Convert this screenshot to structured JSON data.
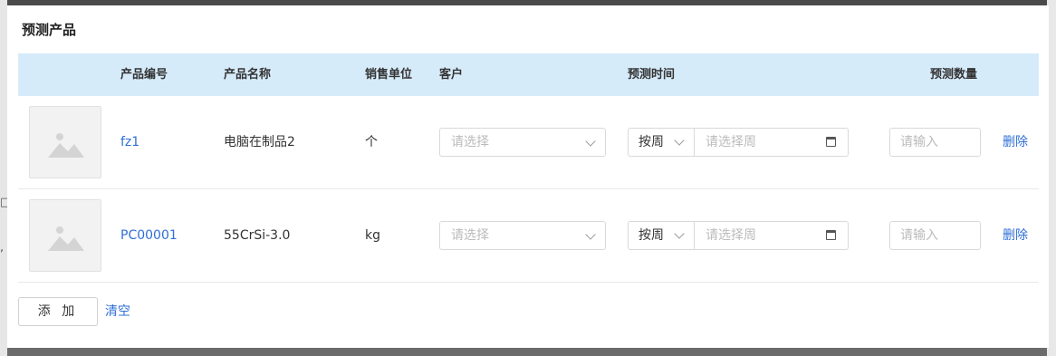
{
  "modal": {
    "title": "预测产品"
  },
  "table": {
    "headers": {
      "code": "产品编号",
      "name": "产品名称",
      "unit": "销售单位",
      "customer": "客户",
      "time": "预测时间",
      "qty": "预测数量"
    },
    "rows": [
      {
        "code": "fz1",
        "name": "电脑在制品2",
        "unit": "个",
        "customer_placeholder": "请选择",
        "period_mode": "按周",
        "week_placeholder": "请选择周",
        "qty_placeholder": "请输入",
        "delete_label": "删除"
      },
      {
        "code": "PC00001",
        "name": "55CrSi-3.0",
        "unit": "kg",
        "customer_placeholder": "请选择",
        "period_mode": "按周",
        "week_placeholder": "请选择周",
        "qty_placeholder": "请输入",
        "delete_label": "删除"
      }
    ]
  },
  "footer": {
    "add_label": "添 加",
    "clear_label": "清空"
  },
  "backdrop": {
    "fragment_1": "□",
    "fragment_2": ","
  },
  "colors": {
    "header_bg": "#d6ebfa",
    "link": "#2f6fd6",
    "border": "#d9d9d9"
  },
  "icons": {
    "thumbnail": "image-placeholder-icon",
    "select": "chevron-down-icon",
    "date": "calendar-icon"
  }
}
